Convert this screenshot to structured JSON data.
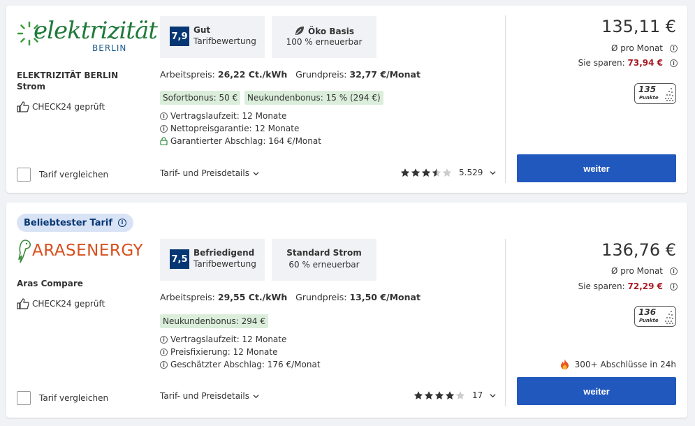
{
  "tariffs": [
    {
      "logo_text": "elektrizität",
      "logo_subtext": "BERLIN",
      "provider_name": "ELEKTRIZITÄT BERLIN",
      "tariff_name": "Strom",
      "checked_label": "CHECK24 geprüft",
      "score": "7,9",
      "score_label": "Gut",
      "score_sub": "Tarifbewertung",
      "eco_title": "Öko Basis",
      "eco_sub": "100 % erneuerbar",
      "arbeitspreis_label": "Arbeitspreis:",
      "arbeitspreis": "26,22 Ct./kWh",
      "grundpreis_label": "Grundpreis:",
      "grundpreis": "32,77 €/Monat",
      "bonuses": [
        "Sofortbonus: 50 €",
        "Neukundenbonus: 15 % (294 €)"
      ],
      "info_rows": [
        {
          "icon": "info-icon",
          "text": "Vertragslaufzeit: 12 Monate"
        },
        {
          "icon": "info-icon",
          "text": "Nettopreisgarantie: 12 Monate"
        },
        {
          "icon": "lock-icon",
          "text": "Garantierter Abschlag: 164 €/Monat"
        }
      ],
      "compare_label": "Tarif vergleichen",
      "details_label": "Tarif- und Preisdetails",
      "rating_stars": 3.5,
      "rating_count": "5.529",
      "price": "135,11 €",
      "per_month": "Ø pro Monat",
      "savings_label": "Sie sparen:",
      "savings_value": "73,94 €",
      "points": "135",
      "points_label": "Punkte",
      "button_label": "weiter"
    },
    {
      "popular_label": "Beliebtester Tarif",
      "logo_text": "ARASENERGY",
      "provider_name": "Aras Compare",
      "checked_label": "CHECK24 geprüft",
      "score": "7,5",
      "score_label": "Befriedigend",
      "score_sub": "Tarifbewertung",
      "eco_title": "Standard Strom",
      "eco_sub": "60 % erneuerbar",
      "arbeitspreis_label": "Arbeitspreis:",
      "arbeitspreis": "29,55 Ct./kWh",
      "grundpreis_label": "Grundpreis:",
      "grundpreis": "13,50 €/Monat",
      "bonuses": [
        "Neukundenbonus: 294 €"
      ],
      "info_rows": [
        {
          "icon": "info-icon",
          "text": "Vertragslaufzeit: 12 Monate"
        },
        {
          "icon": "info-icon",
          "text": "Preisfixierung: 12 Monate"
        },
        {
          "icon": "info-icon",
          "text": "Geschätzter Abschlag: 176 €/Monat"
        }
      ],
      "compare_label": "Tarif vergleichen",
      "details_label": "Tarif- und Preisdetails",
      "rating_stars": 4,
      "rating_count": "17",
      "price": "136,76 €",
      "per_month": "Ø pro Monat",
      "savings_label": "Sie sparen:",
      "savings_value": "72,29 €",
      "points": "136",
      "points_label": "Punkte",
      "deals_text": "300+ Abschlüsse in 24h",
      "button_label": "weiter"
    }
  ],
  "colors": {
    "primary_button": "#2158bd",
    "score_badge": "#063773",
    "savings": "#a81c26",
    "bonus_bg": "#dbeedb",
    "popular_bg": "#d9e3f6"
  }
}
